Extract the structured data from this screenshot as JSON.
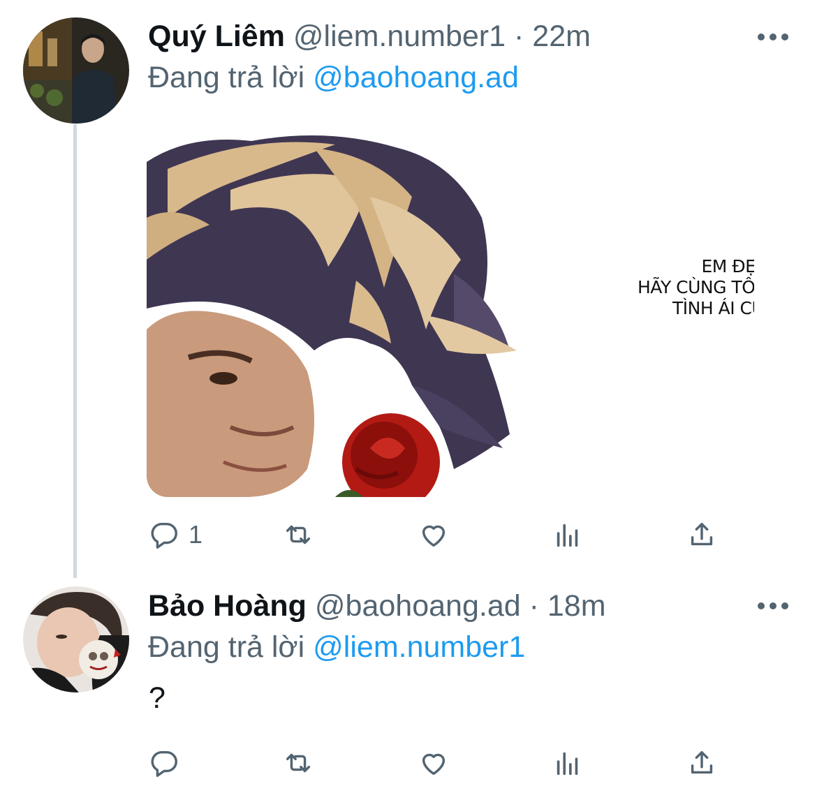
{
  "tweets": [
    {
      "name": "Quý Liêm",
      "handle": "@liem.number1",
      "separator": "·",
      "time": "22m",
      "replying_label": "Đang trả lời",
      "replying_to": "@baohoang.ad",
      "media": {
        "lines": [
          "EM ĐẸP LẮM",
          "HÃY CÙNG TÔI XÂY LÂU ĐÀI",
          "TÌNH ÁI CỦA HAI TA"
        ]
      },
      "actions": {
        "reply_icon": "reply-icon",
        "reply_count": "1",
        "retweet_icon": "retweet-icon",
        "like_icon": "heart-icon",
        "analytics_icon": "analytics-icon",
        "share_icon": "share-icon"
      }
    },
    {
      "name": "Bảo Hoàng",
      "handle": "@baohoang.ad",
      "separator": "·",
      "time": "18m",
      "replying_label": "Đang trả lời",
      "replying_to": "@liem.number1",
      "text": "?",
      "actions": {
        "reply_icon": "reply-icon",
        "retweet_icon": "retweet-icon",
        "like_icon": "heart-icon",
        "analytics_icon": "analytics-icon",
        "share_icon": "share-icon"
      }
    }
  ],
  "colors": {
    "text": "#0f1419",
    "secondary": "#536471",
    "link": "#1d9bf0",
    "thread_line": "#cfd9de"
  }
}
